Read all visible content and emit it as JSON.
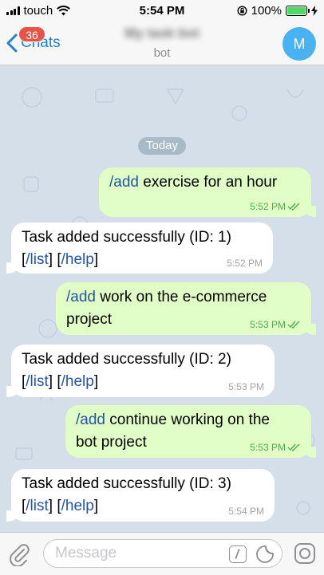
{
  "status_bar": {
    "carrier": "touch",
    "time": "5:54 PM",
    "battery_percent": "100%",
    "battery_level": 1.0,
    "battery_color": "#4cd964"
  },
  "nav": {
    "back_label": "Chats",
    "unread_count": "36",
    "chat_title": "My task bot",
    "chat_subtitle": "bot",
    "avatar_letter": "M",
    "avatar_color": "#4ab2f0",
    "back_icon": "chevron-left-icon"
  },
  "date_separator": "Today",
  "messages": [
    {
      "direction": "out",
      "command": "/add",
      "text_line1": " exercise for an hour",
      "time": "5:52 PM",
      "status": "read"
    },
    {
      "direction": "in",
      "text": "Task added successfully (ID: 1)",
      "link1": "/list",
      "link2": "/help",
      "time": "5:52 PM"
    },
    {
      "direction": "out",
      "command": "/add",
      "text_line1": " work on the e-commerce",
      "text_line2": "project",
      "time": "5:53 PM",
      "status": "read"
    },
    {
      "direction": "in",
      "text": "Task added successfully (ID: 2)",
      "link1": "/list",
      "link2": "/help",
      "time": "5:53 PM"
    },
    {
      "direction": "out",
      "command": "/add",
      "text_line1": " continue working on the",
      "text_line2": "bot project",
      "time": "5:53 PM",
      "status": "read"
    },
    {
      "direction": "in",
      "text": "Task added successfully (ID: 3)",
      "link1": "/list",
      "link2": "/help",
      "time": "5:54 PM"
    }
  ],
  "input": {
    "placeholder": "Message",
    "value": ""
  },
  "colors": {
    "accent": "#2481cc",
    "badge": "#e5534b",
    "outgoing_bubble": "#e1fec6",
    "incoming_bubble": "#ffffff",
    "command_link": "#2455a5",
    "read_check": "#4caf50",
    "chat_background": "#d4dfe9"
  }
}
